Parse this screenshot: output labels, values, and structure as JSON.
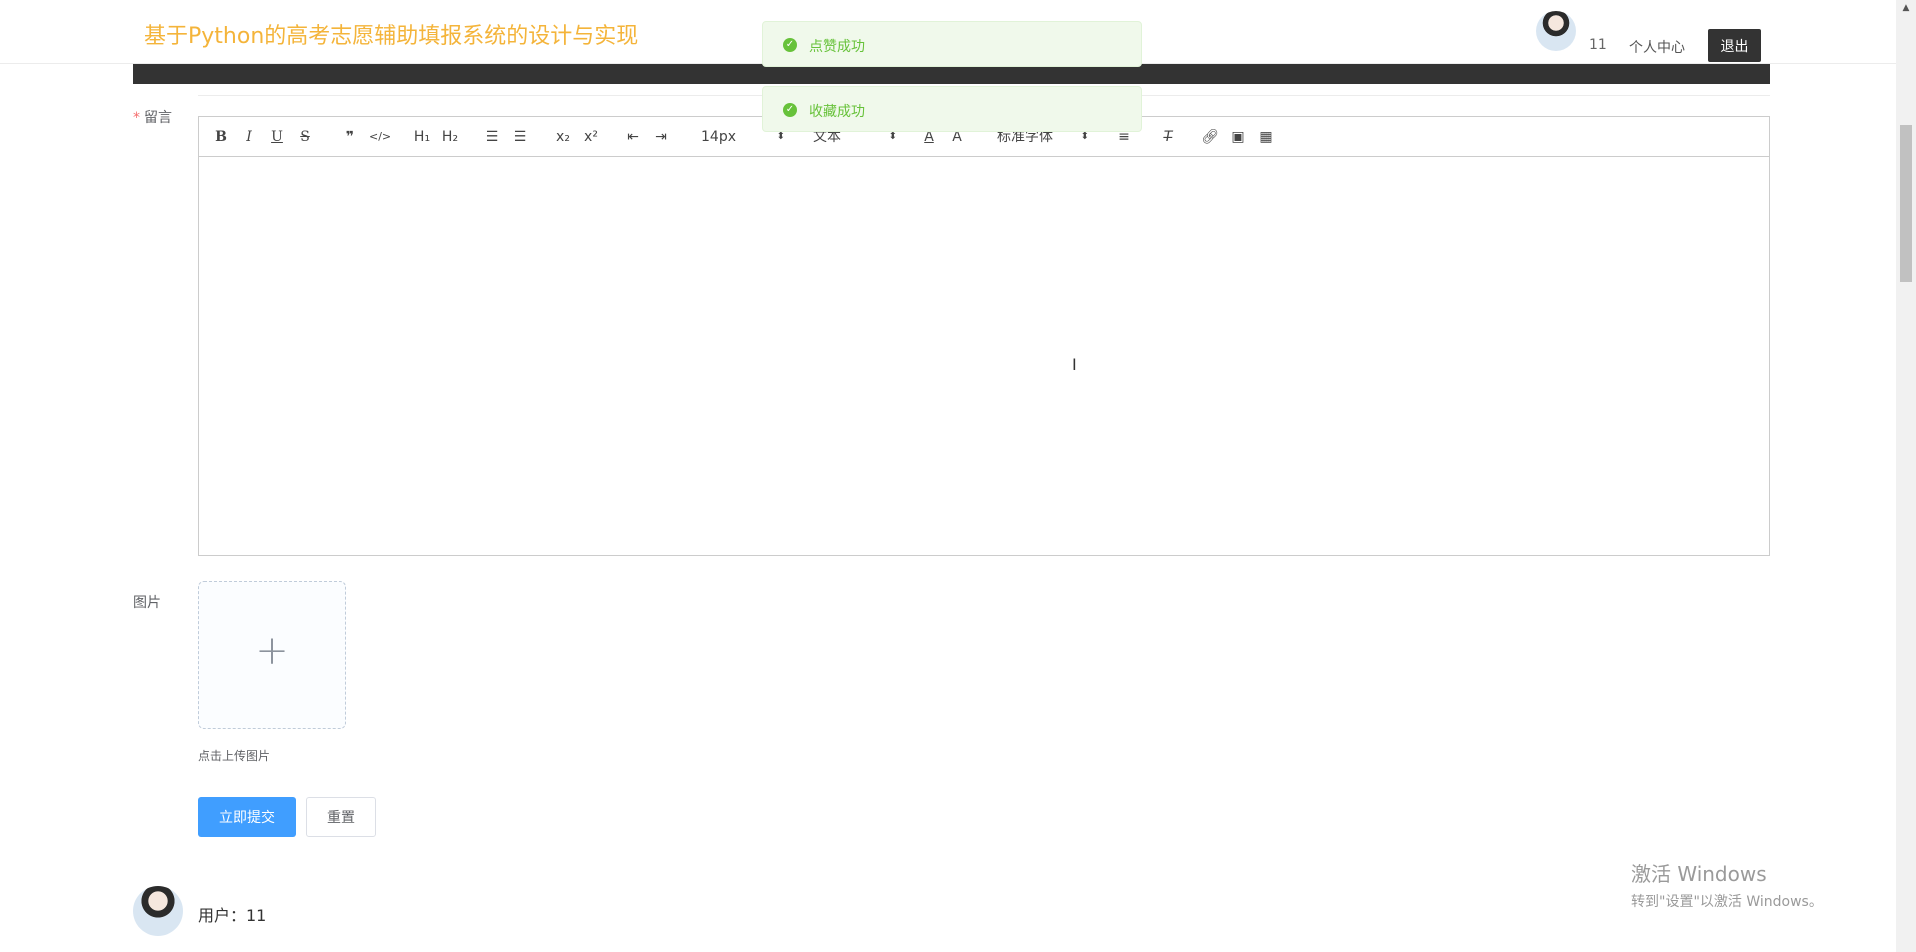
{
  "header": {
    "site_title": "基于Python的高考志愿辅助填报系统的设计与实现",
    "username": "11",
    "personal_center": "个人中心",
    "logout": "退出"
  },
  "toasts": [
    {
      "text": "点赞成功",
      "color": "#67c23a"
    },
    {
      "text": "收藏成功",
      "color": "#67c23a"
    }
  ],
  "form": {
    "message_label": "留言",
    "required_mark": "*",
    "image_label": "图片",
    "upload_tip": "点击上传图片",
    "submit_label": "立即提交",
    "reset_label": "重置"
  },
  "editor": {
    "toolbar": {
      "font_size": "14px",
      "header_select": "文本",
      "font_family": "标准字体",
      "h1": "H₁",
      "h2": "H₂",
      "sub": "x₂",
      "sup": "x²"
    }
  },
  "comment": {
    "user_label": "用户：11"
  },
  "watermark": {
    "line1": "激活 Windows",
    "line2": "转到\"设置\"以激活 Windows。"
  },
  "colors": {
    "title": "#f4b43a",
    "primary": "#409eff",
    "dark": "#333333"
  }
}
